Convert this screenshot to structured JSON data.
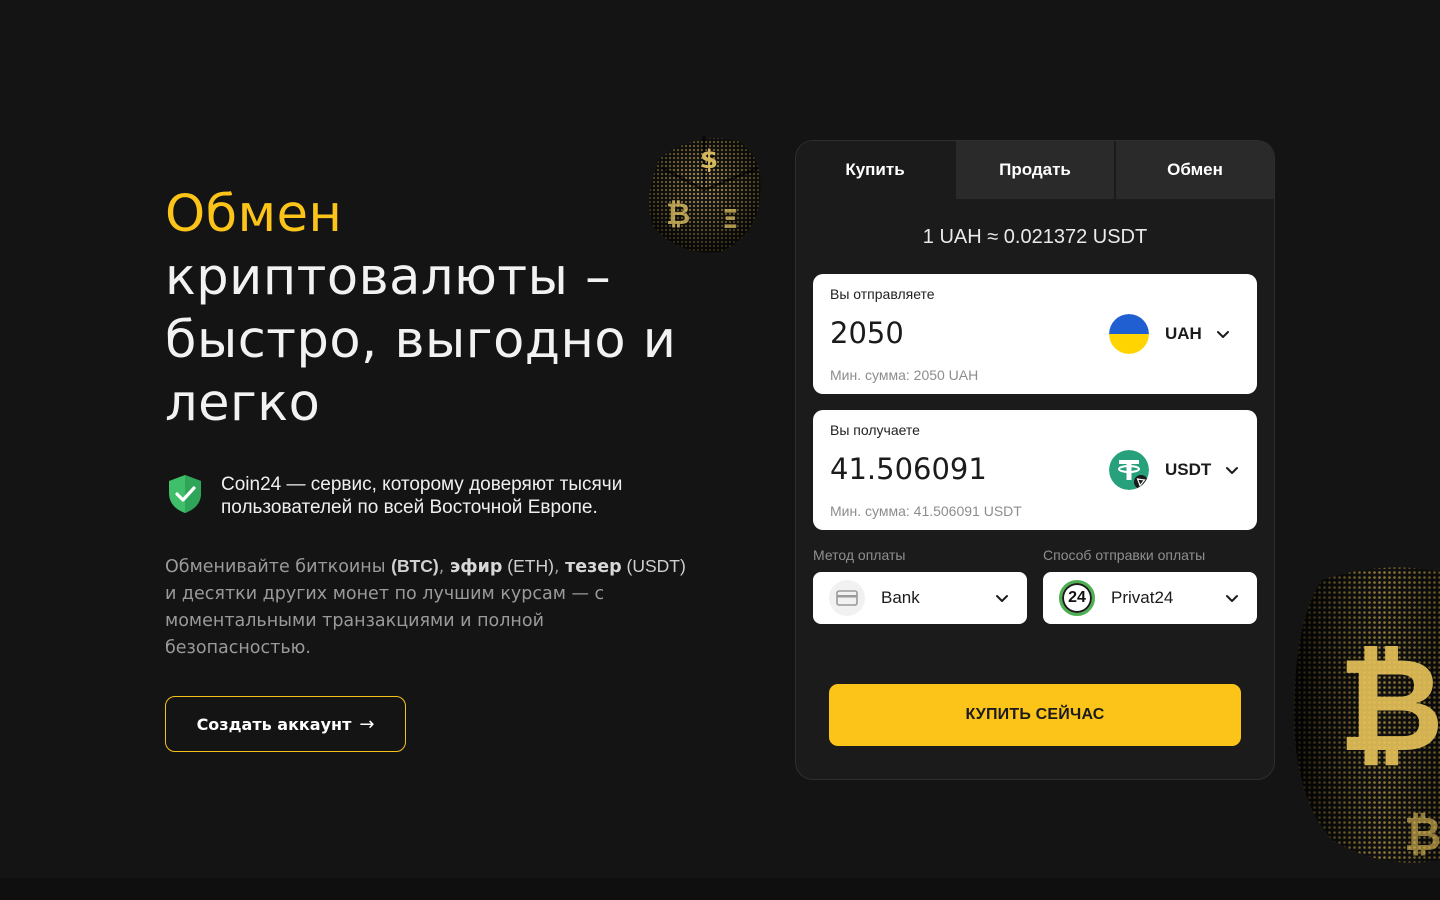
{
  "hero": {
    "title_accent": "Обмен",
    "title_rest": "криптовалюты – быстро, выгодно и легко",
    "trust_text": "Coin24 — сервис, которому доверяют тысячи пользователей по всей Восточной Европе.",
    "desc": {
      "p1": "Обменивайте биткоины ",
      "btc_ticker": "(BTC)",
      "p2": ", ",
      "eth_word": "эфир",
      "eth_ticker": " (ETH)",
      "p3": ", ",
      "usdt_word": "тезер",
      "usdt_ticker": " (USDT)",
      "p4": " и десятки других монет по лучшим курсам — с моментальными транзакциями и полной безопасностью."
    },
    "cta_label": "Создать аккаунт",
    "cta_arrow": "→"
  },
  "widget": {
    "tabs": [
      {
        "label": "Купить",
        "active": true
      },
      {
        "label": "Продать",
        "active": false
      },
      {
        "label": "Обмен",
        "active": false
      }
    ],
    "rate": "1 UAH ≈ 0.021372 USDT",
    "send": {
      "label": "Вы отправляете",
      "amount": "2050",
      "min": "Мин. сумма: 2050 UAH",
      "currency": "UAH",
      "icon": "ukraine-flag-icon"
    },
    "receive": {
      "label": "Вы получаете",
      "amount": "41.506091",
      "min": "Мин. сумма: 41.506091 USDT",
      "currency": "USDT",
      "icon": "tether-icon"
    },
    "payment_method": {
      "label": "Метод оплаты",
      "value": "Bank",
      "icon": "card-icon"
    },
    "payment_channel": {
      "label": "Способ отправки оплаты",
      "value": "Privat24",
      "badge": "24"
    },
    "buy_label": "КУПИТЬ СЕЙЧАС"
  },
  "colors": {
    "background": "#141414",
    "accent": "#fcc419",
    "panel": "#1b1b1b",
    "tab_inactive": "#2a2a2a",
    "tether": "#26a17b",
    "shield": "#3fbf6a"
  }
}
